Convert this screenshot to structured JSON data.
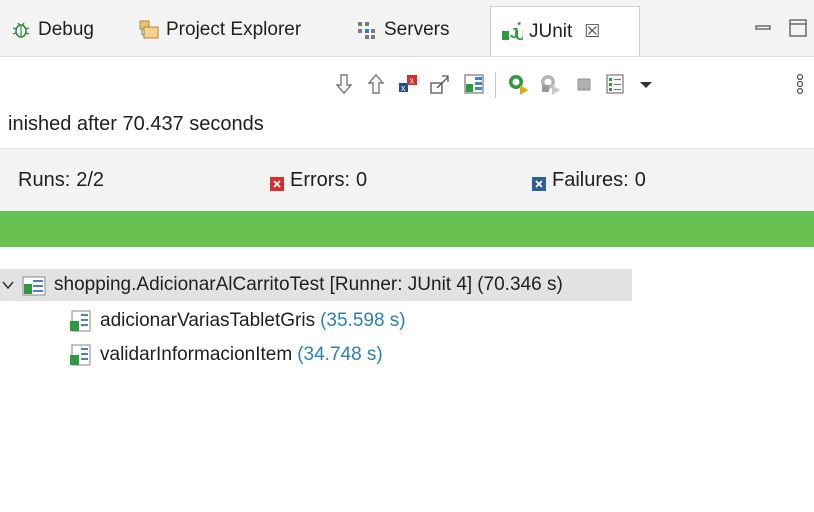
{
  "tabs": [
    {
      "label": "Debug",
      "icon": "debug-bug-icon",
      "active": false
    },
    {
      "label": "Project Explorer",
      "icon": "project-explorer-icon",
      "active": false
    },
    {
      "label": "Servers",
      "icon": "servers-icon",
      "active": false
    },
    {
      "label": "JUnit",
      "icon": "junit-icon",
      "active": true
    }
  ],
  "tab_close_glyph": "☒",
  "status": {
    "finished_text": "inished after 70.437 seconds"
  },
  "counters": {
    "runs_label": "Runs:",
    "runs_value": "2/2",
    "errors_label": "Errors:",
    "errors_value": "0",
    "failures_label": "Failures:",
    "failures_value": "0"
  },
  "progress": {
    "fraction": 1.0,
    "color": "#68c150"
  },
  "tree": {
    "root": {
      "name": "shopping.AdicionarAlCarritoTest [Runner: JUnit 4]",
      "time": "(70.346 s)",
      "expanded": true,
      "selected": true
    },
    "children": [
      {
        "name": "adicionarVariasTabletGris",
        "time": "(35.598 s)"
      },
      {
        "name": "validarInformacionItem",
        "time": "(34.748 s)"
      }
    ]
  },
  "colors": {
    "accent_green": "#68c150",
    "time_blue": "#2a7fb8",
    "error_red": "#d62d2d",
    "failure_blue": "#2f5c9a"
  },
  "toolbar_icons": [
    "next-failure-icon",
    "previous-failure-icon",
    "show-failures-only-icon",
    "scroll-lock-icon",
    "layout-icon",
    "rerun-test-icon",
    "rerun-failed-first-icon",
    "stop-icon",
    "history-icon",
    "view-menu-icon",
    "overflow-icon"
  ]
}
